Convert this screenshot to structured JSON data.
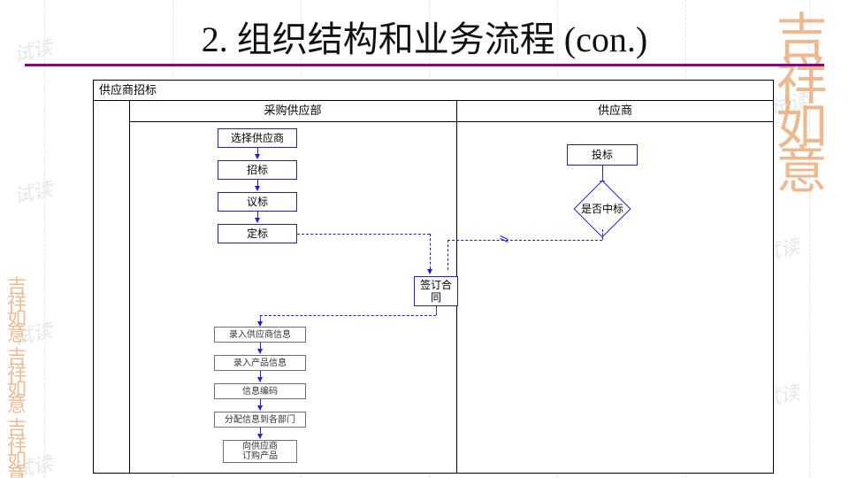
{
  "title": "2. 组织结构和业务流程 (con.)",
  "frame_title": "供应商招标",
  "lanes": {
    "left": "采购供应部",
    "right": "供应商"
  },
  "left_steps": {
    "s1": "选择供应商",
    "s2": "招标",
    "s3": "议标",
    "s4": "定标"
  },
  "right_steps": {
    "r1": "投标",
    "decision": "是否中标"
  },
  "center_step": "签订合\n同",
  "sub_steps": {
    "a1": "录入供应商信息",
    "a2": "录入产品信息",
    "a3": "信息编码",
    "a4": "分配信息到各部门",
    "a5": "向供应商\n订购产品"
  },
  "watermark_text": "试读",
  "seal_text": "吉祥如意",
  "seal_small_text": "吉祥如意"
}
